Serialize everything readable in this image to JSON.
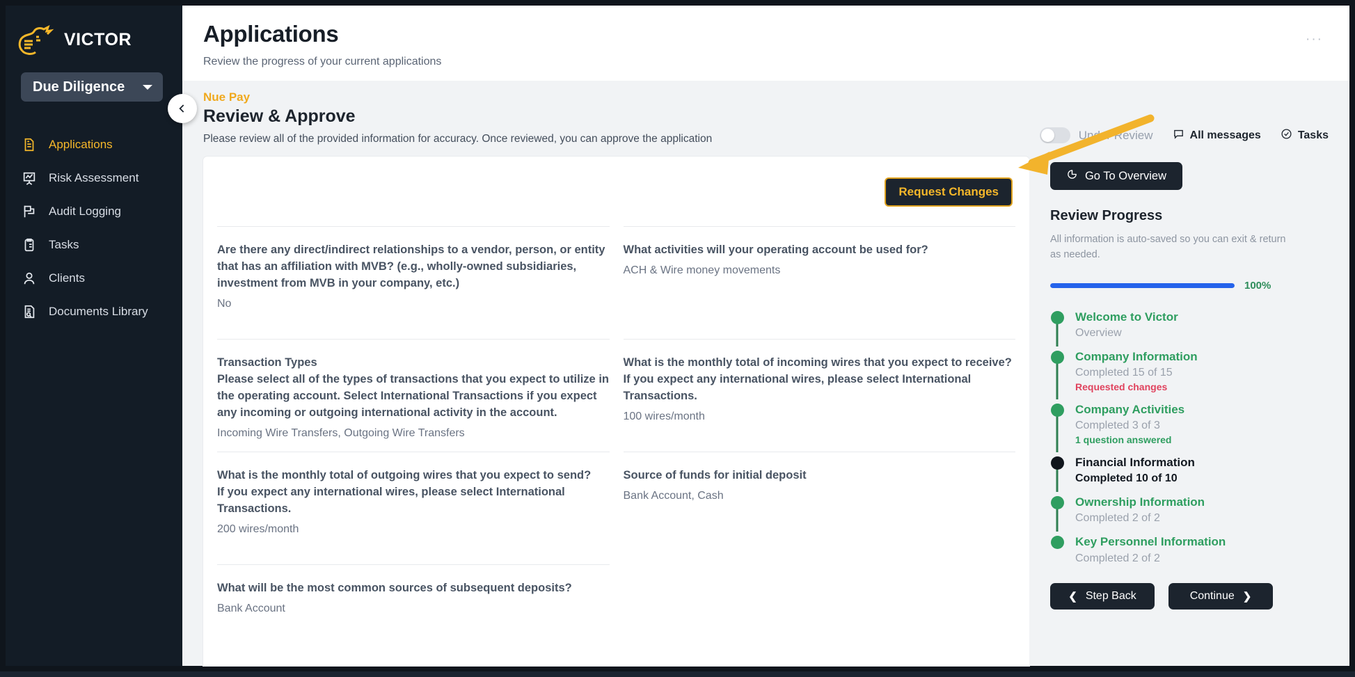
{
  "sidebar": {
    "brand": "VICTOR",
    "workspace_select": "Due Diligence",
    "items": [
      {
        "label": "Applications",
        "icon": "document-icon",
        "active": true
      },
      {
        "label": "Risk Assessment",
        "icon": "chart-board-icon",
        "active": false
      },
      {
        "label": "Audit Logging",
        "icon": "flag-icon",
        "active": false
      },
      {
        "label": "Tasks",
        "icon": "clipboard-icon",
        "active": false
      },
      {
        "label": "Clients",
        "icon": "user-icon",
        "active": false
      },
      {
        "label": "Documents Library",
        "icon": "document-search-icon",
        "active": false
      }
    ]
  },
  "header": {
    "title": "Applications",
    "subtitle": "Review the progress of your current applications",
    "kebab": "···"
  },
  "subheader": {
    "eyebrow": "Nue Pay",
    "title": "Review & Approve",
    "description": "Please review all of the provided information for accuracy. Once reviewed, you can approve the application",
    "toggle_label": "Under Review",
    "toggle_on": false,
    "all_messages": "All messages",
    "tasks": "Tasks"
  },
  "content": {
    "request_changes": "Request Changes",
    "questions": [
      {
        "question": "Are there any direct/indirect relationships to a vendor, person, or entity that has an affiliation with MVB? (e.g., wholly-owned subsidiaries, investment from MVB in your company, etc.)",
        "answer": "No"
      },
      {
        "question": "What activities will your operating account be used for?",
        "answer": "ACH & Wire money movements"
      },
      {
        "question": "Transaction Types\nPlease select all of the types of transactions that you expect to utilize in the operating account. Select International Transactions if you expect any incoming or outgoing international activity in the account.",
        "answer": "Incoming Wire Transfers, Outgoing Wire Transfers"
      },
      {
        "question": "What is the monthly total of incoming wires that you expect to receive?\nIf you expect any international wires, please select International Transactions.",
        "answer": "100 wires/month"
      },
      {
        "question": "What is the monthly total of outgoing wires that you expect to send?\nIf you expect any international wires, please select International Transactions.",
        "answer": "200 wires/month"
      },
      {
        "question": "Source of funds for initial deposit",
        "answer": "Bank Account, Cash"
      },
      {
        "question": "What will be the most common sources of subsequent deposits?",
        "answer": "Bank Account"
      }
    ]
  },
  "right_panel": {
    "go_to_overview": "Go To Overview",
    "title": "Review Progress",
    "description": "All information is auto-saved so you can exit & return as needed.",
    "progress_percent": "100%",
    "progress_value": 100,
    "steps": [
      {
        "name": "Welcome to Victor",
        "sub": "Overview",
        "note": "",
        "note_type": "",
        "state": "done"
      },
      {
        "name": "Company Information",
        "sub": "Completed 15 of 15",
        "note": "Requested changes",
        "note_type": "warn",
        "state": "done"
      },
      {
        "name": "Company Activities",
        "sub": "Completed 3 of 3",
        "note": "1 question answered",
        "note_type": "ok",
        "state": "done"
      },
      {
        "name": "Financial Information",
        "sub": "Completed 10 of 10",
        "note": "",
        "note_type": "",
        "state": "current"
      },
      {
        "name": "Ownership Information",
        "sub": "Completed 2 of 2",
        "note": "",
        "note_type": "",
        "state": "done"
      },
      {
        "name": "Key Personnel Information",
        "sub": "Completed 2 of 2",
        "note": "",
        "note_type": "",
        "state": "done"
      }
    ],
    "step_back": "Step Back",
    "continue": "Continue"
  },
  "colors": {
    "brand_yellow": "#f5b72a",
    "sidebar_bg": "#131c26",
    "progress_blue": "#2563eb",
    "step_green": "#2f9e60",
    "warn_red": "#e0435e",
    "annotation_arrow": "#f2b32c"
  }
}
